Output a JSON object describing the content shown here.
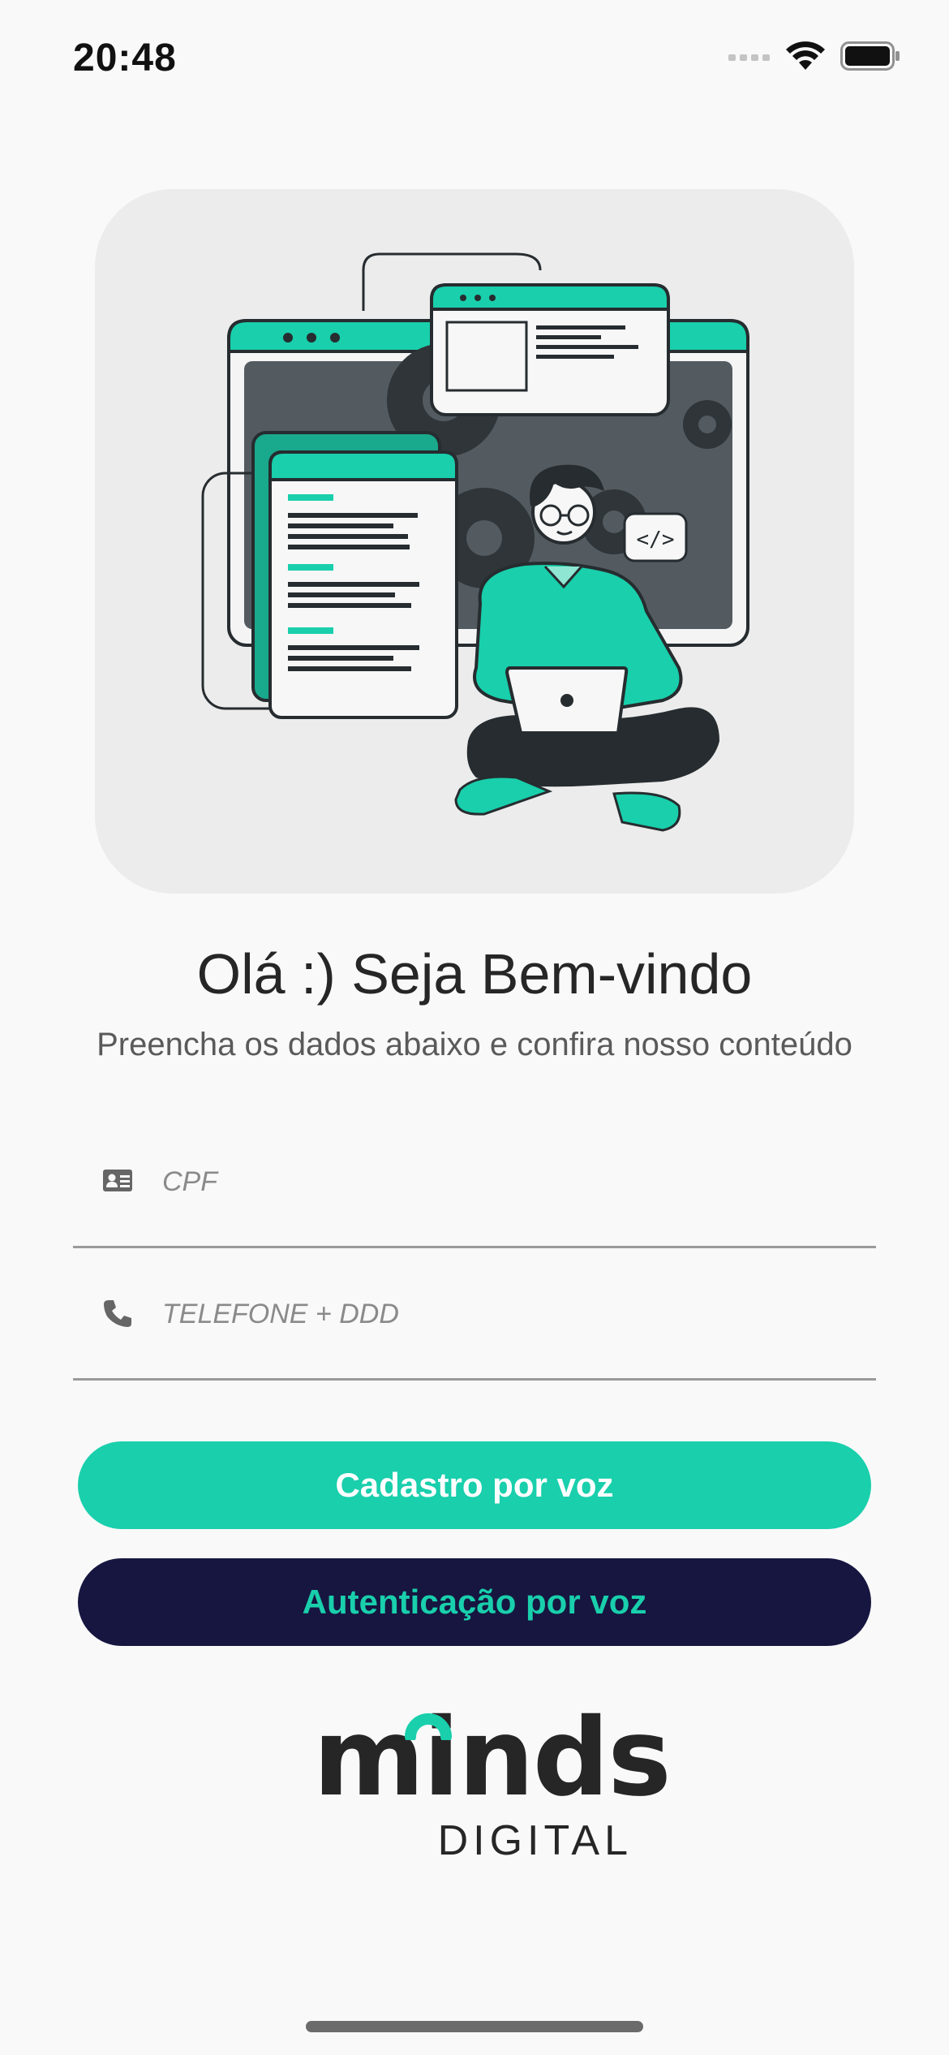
{
  "status_bar": {
    "time": "20:48",
    "icons": [
      "signal-icon",
      "wifi-icon",
      "battery-icon"
    ]
  },
  "hero": {
    "illustration": "developer-with-laptop-illustration"
  },
  "welcome": {
    "title": "Olá :) Seja Bem-vindo",
    "subtitle": "Preencha os dados abaixo e confira nosso conteúdo"
  },
  "form": {
    "cpf": {
      "placeholder": "CPF",
      "value": "",
      "icon": "id-card-icon"
    },
    "phone": {
      "placeholder": "TELEFONE + DDD",
      "value": "",
      "icon": "phone-icon"
    }
  },
  "actions": {
    "register_label": "Cadastro por voz",
    "auth_label": "Autenticação por voz"
  },
  "brand": {
    "name": "minds",
    "sub": "DIGITAL"
  },
  "colors": {
    "accent": "#19cfac",
    "dark": "#161640",
    "background": "#f9f9f9",
    "text": "#262626"
  }
}
